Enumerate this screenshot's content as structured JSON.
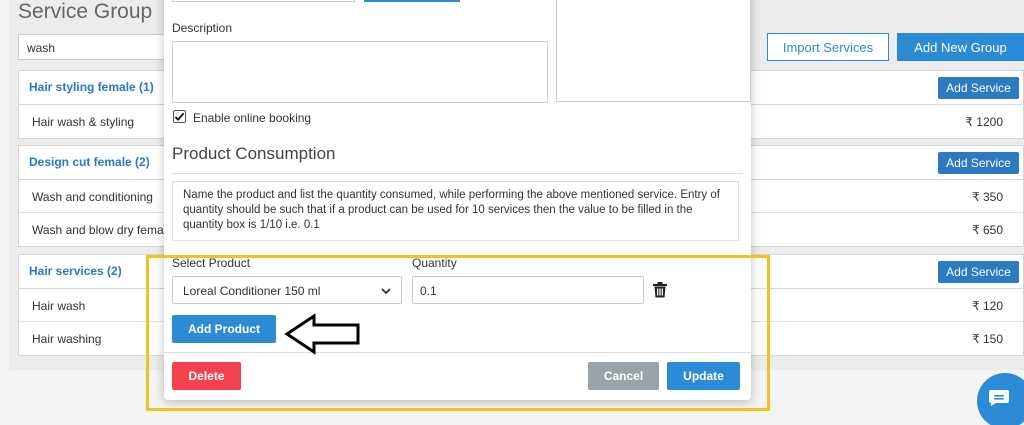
{
  "page": {
    "title": "Service Group",
    "search_value": "wash",
    "import_label": "Import Services",
    "add_group_label": "Add New Group"
  },
  "groups": [
    {
      "title": "Hair styling female (1)",
      "add_label": "Add Service",
      "services": [
        {
          "name": "Hair wash & styling",
          "price": "₹ 1200"
        }
      ]
    },
    {
      "title": "Design cut female (2)",
      "add_label": "Add Service",
      "services": [
        {
          "name": "Wash and conditioning",
          "price": "₹ 350"
        },
        {
          "name": "Wash and blow dry femal",
          "price": "₹ 650"
        }
      ]
    },
    {
      "title": "Hair services (2)",
      "add_label": "Add Service",
      "services": [
        {
          "name": "Hair wash",
          "price": "₹ 120"
        },
        {
          "name": "Hair washing",
          "price": "₹ 150"
        }
      ]
    }
  ],
  "modal": {
    "description_label": "Description",
    "description_value": "",
    "online_booking_label": "Enable online booking",
    "online_booking_checked": true,
    "section_title": "Product Consumption",
    "info_text": "Name the product and list the quantity consumed, while performing the above mentioned service. Entry of quantity should be such that if a product can be used for 10 services then the value to be filled in the quantity box is 1/10 i.e. 0.1",
    "select_label": "Select Product",
    "selected_product": "Loreal Conditioner 150 ml",
    "quantity_label": "Quantity",
    "quantity_value": "0.1",
    "add_product_label": "Add Product",
    "delete_label": "Delete",
    "cancel_label": "Cancel",
    "update_label": "Update"
  },
  "icons": {
    "trash": "trash-icon",
    "chevron": "chevron-down-icon",
    "check": "check-icon",
    "arrow": "left-arrow-icon",
    "chat": "chat-icon"
  },
  "colors": {
    "primary": "#2b8bd6",
    "danger": "#f5424f",
    "neutral": "#9aa3a8",
    "highlight": "#f5c11f"
  }
}
